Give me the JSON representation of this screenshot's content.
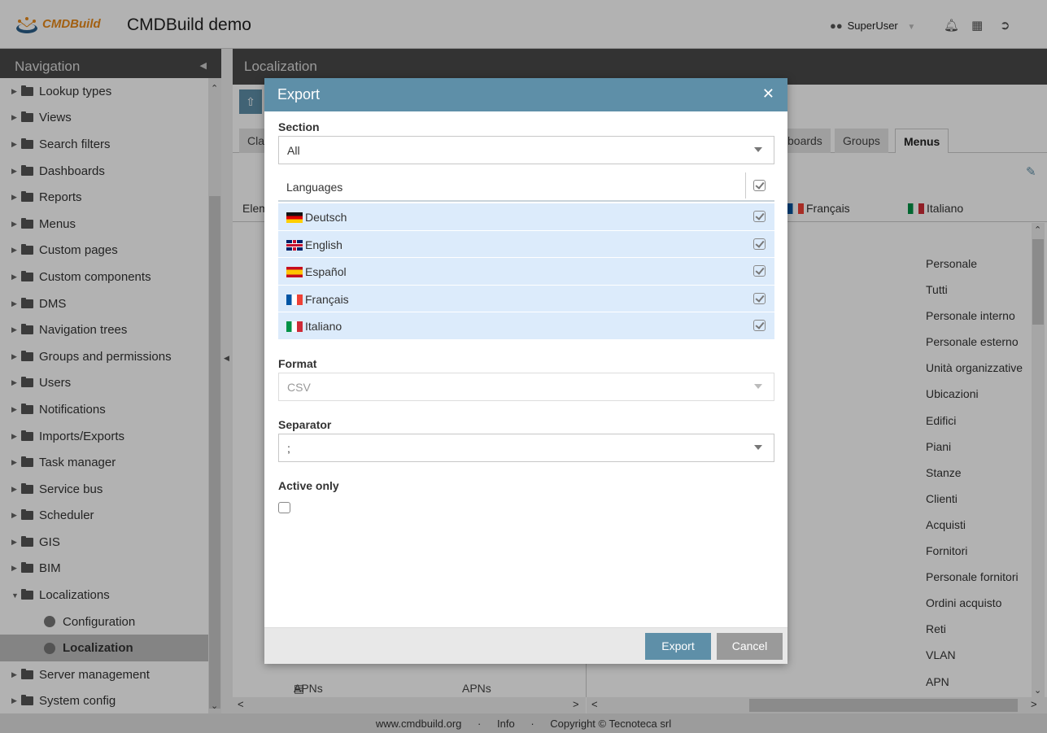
{
  "header": {
    "logo_text": "CMDBuild",
    "app_title": "CMDBuild demo",
    "user_name": "SuperUser",
    "icons": [
      "users-icon",
      "bell-icon",
      "grid-icon",
      "logout-icon"
    ]
  },
  "navigation": {
    "title": "Navigation",
    "items": [
      {
        "label": "Lookup types",
        "type": "folder"
      },
      {
        "label": "Views",
        "type": "folder"
      },
      {
        "label": "Search filters",
        "type": "folder"
      },
      {
        "label": "Dashboards",
        "type": "folder"
      },
      {
        "label": "Reports",
        "type": "folder"
      },
      {
        "label": "Menus",
        "type": "folder"
      },
      {
        "label": "Custom pages",
        "type": "folder"
      },
      {
        "label": "Custom components",
        "type": "folder"
      },
      {
        "label": "DMS",
        "type": "folder"
      },
      {
        "label": "Navigation trees",
        "type": "folder"
      },
      {
        "label": "Groups and permissions",
        "type": "folder"
      },
      {
        "label": "Users",
        "type": "folder"
      },
      {
        "label": "Notifications",
        "type": "folder"
      },
      {
        "label": "Imports/Exports",
        "type": "folder"
      },
      {
        "label": "Task manager",
        "type": "folder"
      },
      {
        "label": "Service bus",
        "type": "folder"
      },
      {
        "label": "Scheduler",
        "type": "folder"
      },
      {
        "label": "GIS",
        "type": "folder"
      },
      {
        "label": "BIM",
        "type": "folder"
      },
      {
        "label": "Localizations",
        "type": "folder-open"
      },
      {
        "label": "Configuration",
        "type": "sub"
      },
      {
        "label": "Localization",
        "type": "sub-active"
      },
      {
        "label": "Server management",
        "type": "folder"
      },
      {
        "label": "System config",
        "type": "folder"
      }
    ]
  },
  "main": {
    "title": "Localization",
    "tabs": {
      "cla": "Cla",
      "dashboards": "boards",
      "groups": "Groups",
      "menus": "Menus"
    },
    "grid_head": {
      "element": "Elem",
      "francais": "Français",
      "italiano": "Italiano"
    },
    "italiano_values": [
      "Personale",
      "Tutti",
      "Personale interno",
      "Personale esterno",
      "Unità organizzative",
      "Ubicazioni",
      "Edifici",
      "Piani",
      "Stanze",
      "Clienti",
      "Acquisti",
      "Fornitori",
      "Personale fornitori",
      "Ordini acquisto",
      "Reti",
      "VLAN",
      "APN"
    ],
    "row_apns_left": "APNs",
    "row_apns_right": "APNs",
    "row_partial_left": "APNs",
    "row_partial_right": "APNs"
  },
  "modal": {
    "title": "Export",
    "section_label": "Section",
    "section_value": "All",
    "languages_header": "Languages",
    "languages": [
      {
        "name": "Deutsch",
        "flag": "de",
        "checked": true
      },
      {
        "name": "English",
        "flag": "gb",
        "checked": true
      },
      {
        "name": "Español",
        "flag": "es",
        "checked": true
      },
      {
        "name": "Français",
        "flag": "fr",
        "checked": true
      },
      {
        "name": "Italiano",
        "flag": "it",
        "checked": true
      }
    ],
    "format_label": "Format",
    "format_value": "CSV",
    "separator_label": "Separator",
    "separator_value": ";",
    "active_only_label": "Active only",
    "active_only_checked": false,
    "export_button": "Export",
    "cancel_button": "Cancel"
  },
  "footer": {
    "site": "www.cmdbuild.org",
    "info": "Info",
    "copyright": "Copyright © Tecnoteca srl",
    "sep": "·"
  },
  "colors": {
    "accent": "#5e8fa8",
    "header_dark": "#4a4a4a",
    "selection": "#dcebfb"
  }
}
